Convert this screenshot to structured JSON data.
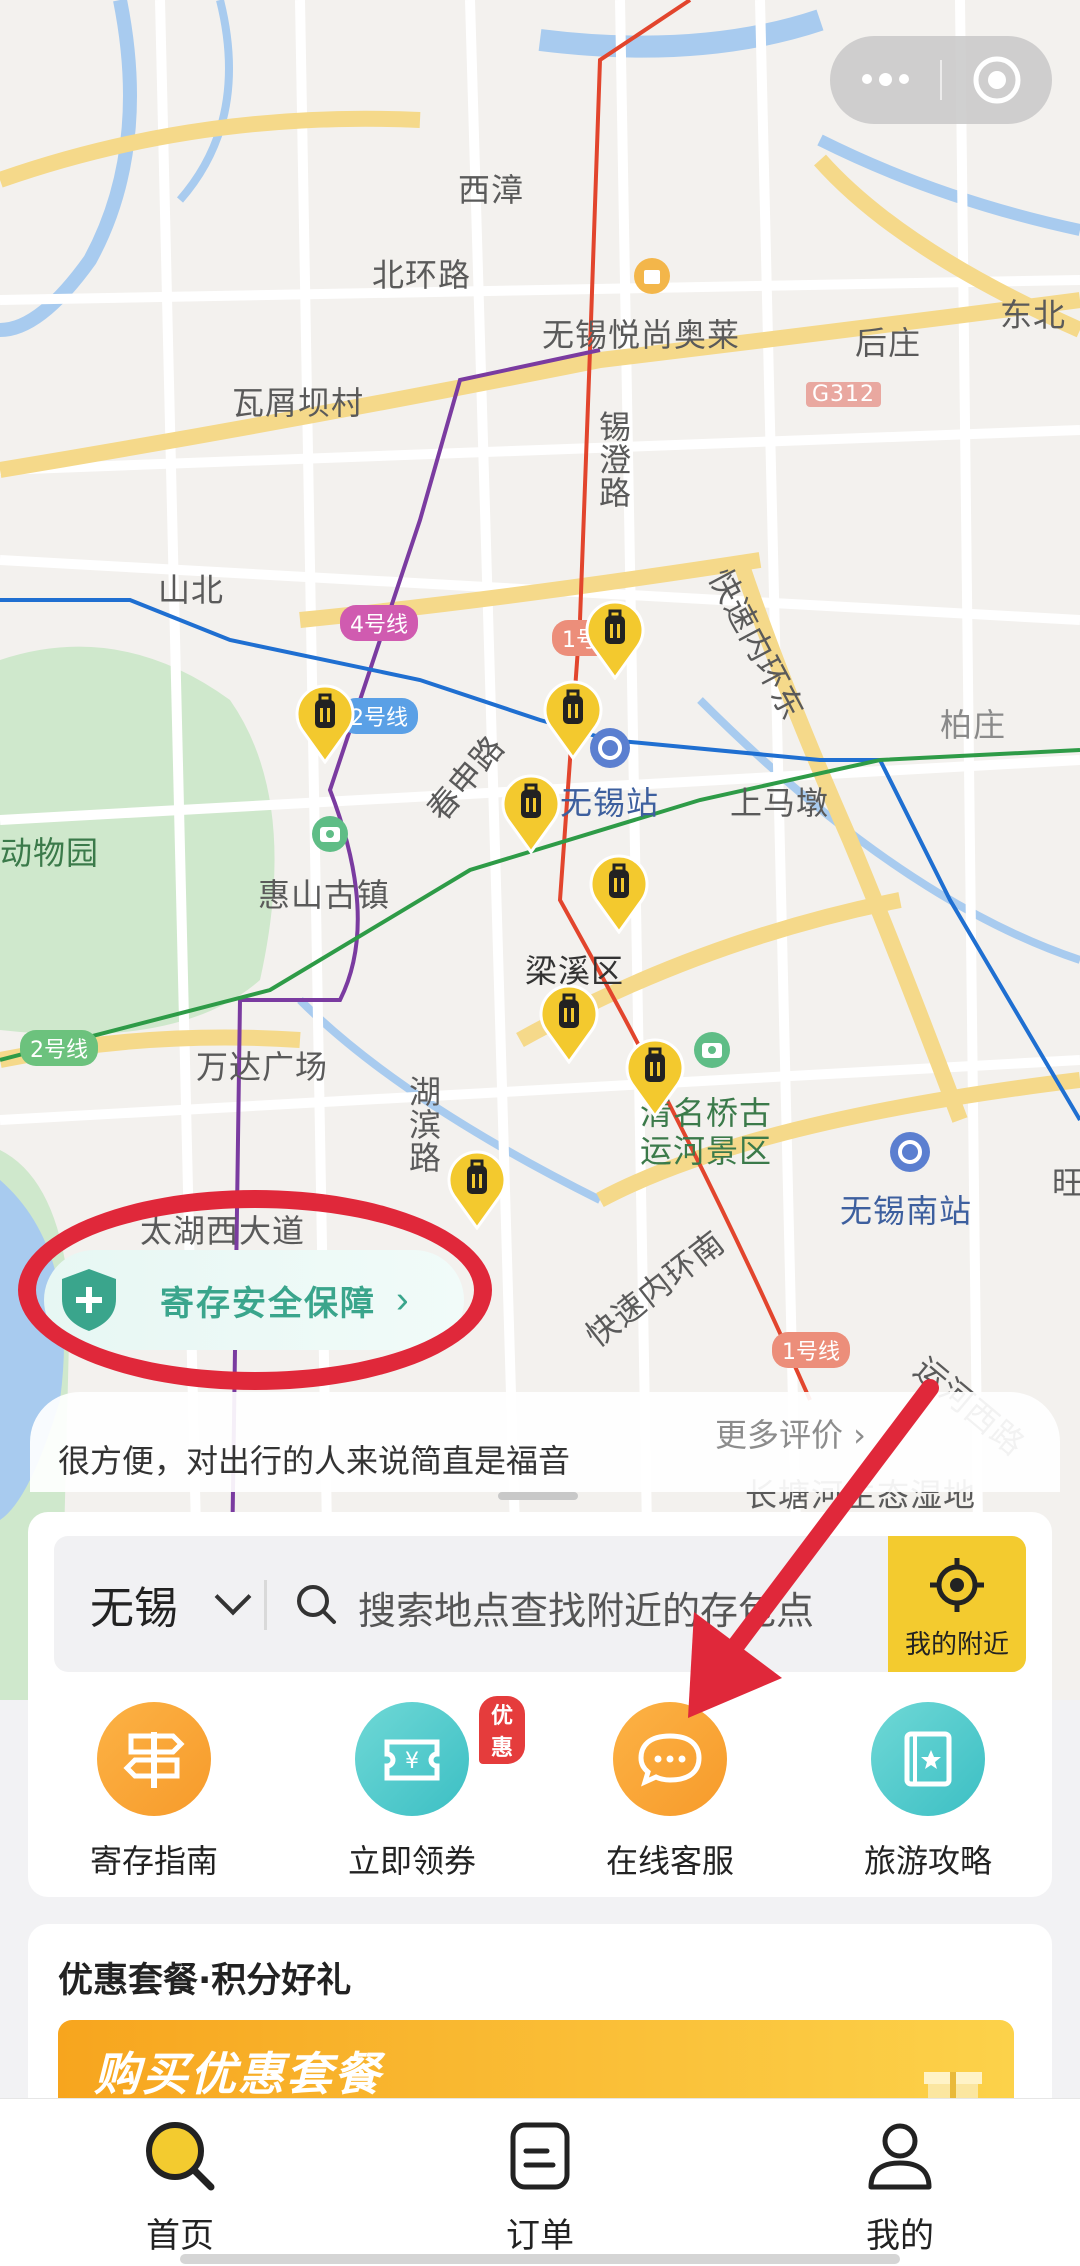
{
  "capsule": {
    "more_icon": "more-dots-icon",
    "close_icon": "target-circle-icon"
  },
  "map": {
    "labels": {
      "xizhang": "西漳",
      "beihuan": "北环路",
      "yuesh": "无锡悦尚奥莱",
      "houzhuang": "后庄",
      "dongbei": "东北",
      "wapeng": "瓦屑坝村",
      "g312": "G312",
      "xiyuan": "锡澄路",
      "shanbei": "山北",
      "kuaisu_east": "快速内环东",
      "line4": "4号线",
      "line1": "1号线",
      "line2a": "2号线",
      "chuntian": "春申路",
      "wuxi_station": "无锡站",
      "shangmadun": "上马墩",
      "baizhuang": "柏庄",
      "dongwuyuan": "动物园",
      "huishan": "惠山古镇",
      "liangxi": "梁溪区",
      "line2b": "2号线",
      "wanda": "万达广场",
      "qingming": "清名桥古",
      "yunhe": "运河景区",
      "hubin": "湖滨路",
      "south_station": "无锡南站",
      "wang": "旺",
      "taihu": "太湖西大道",
      "kuaisu_south": "快速内环南",
      "line1b": "1号线",
      "yunhe_west": "运河西路",
      "changtang": "长塘河生态湿地"
    }
  },
  "safety_banner": {
    "label": "寄存安全保障",
    "chevron": "›"
  },
  "review": {
    "quote": "很方便，对出行的人来说简直是福音",
    "more": "更多评价 ›"
  },
  "search": {
    "city": "无锡",
    "placeholder": "搜索地点查找附近的存包点",
    "nearby_label": "我的附近"
  },
  "quick_actions": [
    {
      "label": "寄存指南",
      "icon": "signpost-icon"
    },
    {
      "label": "立即领券",
      "icon": "coupon-icon",
      "badge": "优惠"
    },
    {
      "label": "在线客服",
      "icon": "chat-bubble-icon"
    },
    {
      "label": "旅游攻略",
      "icon": "guidebook-icon"
    }
  ],
  "promo": {
    "title": "优惠套餐·积分好礼",
    "banner_text": "购买优惠套餐"
  },
  "tabs": [
    {
      "label": "首页",
      "icon": "search-icon",
      "active": true
    },
    {
      "label": "订单",
      "icon": "order-icon",
      "active": false
    },
    {
      "label": "我的",
      "icon": "profile-icon",
      "active": false
    }
  ],
  "colors": {
    "accent": "#f3cb2f",
    "annotation": "#e0283a",
    "safety_green": "#3aa58c"
  }
}
